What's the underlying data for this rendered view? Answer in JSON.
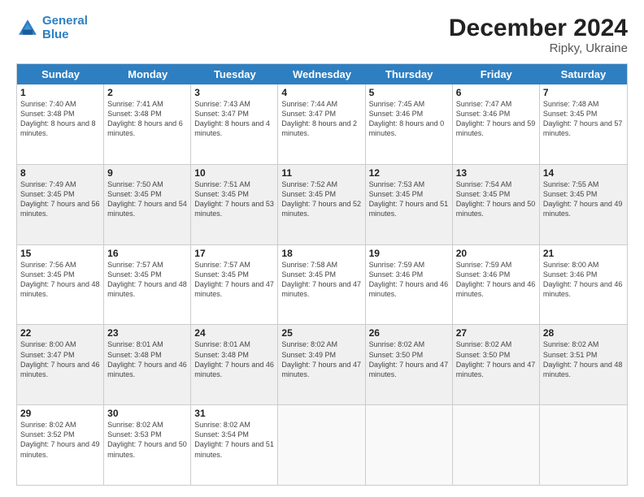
{
  "header": {
    "logo_line1": "General",
    "logo_line2": "Blue",
    "title": "December 2024",
    "subtitle": "Ripky, Ukraine"
  },
  "days_of_week": [
    "Sunday",
    "Monday",
    "Tuesday",
    "Wednesday",
    "Thursday",
    "Friday",
    "Saturday"
  ],
  "weeks": [
    [
      {
        "day": "1",
        "sunrise": "Sunrise: 7:40 AM",
        "sunset": "Sunset: 3:48 PM",
        "daylight": "Daylight: 8 hours and 8 minutes."
      },
      {
        "day": "2",
        "sunrise": "Sunrise: 7:41 AM",
        "sunset": "Sunset: 3:48 PM",
        "daylight": "Daylight: 8 hours and 6 minutes."
      },
      {
        "day": "3",
        "sunrise": "Sunrise: 7:43 AM",
        "sunset": "Sunset: 3:47 PM",
        "daylight": "Daylight: 8 hours and 4 minutes."
      },
      {
        "day": "4",
        "sunrise": "Sunrise: 7:44 AM",
        "sunset": "Sunset: 3:47 PM",
        "daylight": "Daylight: 8 hours and 2 minutes."
      },
      {
        "day": "5",
        "sunrise": "Sunrise: 7:45 AM",
        "sunset": "Sunset: 3:46 PM",
        "daylight": "Daylight: 8 hours and 0 minutes."
      },
      {
        "day": "6",
        "sunrise": "Sunrise: 7:47 AM",
        "sunset": "Sunset: 3:46 PM",
        "daylight": "Daylight: 7 hours and 59 minutes."
      },
      {
        "day": "7",
        "sunrise": "Sunrise: 7:48 AM",
        "sunset": "Sunset: 3:45 PM",
        "daylight": "Daylight: 7 hours and 57 minutes."
      }
    ],
    [
      {
        "day": "8",
        "sunrise": "Sunrise: 7:49 AM",
        "sunset": "Sunset: 3:45 PM",
        "daylight": "Daylight: 7 hours and 56 minutes."
      },
      {
        "day": "9",
        "sunrise": "Sunrise: 7:50 AM",
        "sunset": "Sunset: 3:45 PM",
        "daylight": "Daylight: 7 hours and 54 minutes."
      },
      {
        "day": "10",
        "sunrise": "Sunrise: 7:51 AM",
        "sunset": "Sunset: 3:45 PM",
        "daylight": "Daylight: 7 hours and 53 minutes."
      },
      {
        "day": "11",
        "sunrise": "Sunrise: 7:52 AM",
        "sunset": "Sunset: 3:45 PM",
        "daylight": "Daylight: 7 hours and 52 minutes."
      },
      {
        "day": "12",
        "sunrise": "Sunrise: 7:53 AM",
        "sunset": "Sunset: 3:45 PM",
        "daylight": "Daylight: 7 hours and 51 minutes."
      },
      {
        "day": "13",
        "sunrise": "Sunrise: 7:54 AM",
        "sunset": "Sunset: 3:45 PM",
        "daylight": "Daylight: 7 hours and 50 minutes."
      },
      {
        "day": "14",
        "sunrise": "Sunrise: 7:55 AM",
        "sunset": "Sunset: 3:45 PM",
        "daylight": "Daylight: 7 hours and 49 minutes."
      }
    ],
    [
      {
        "day": "15",
        "sunrise": "Sunrise: 7:56 AM",
        "sunset": "Sunset: 3:45 PM",
        "daylight": "Daylight: 7 hours and 48 minutes."
      },
      {
        "day": "16",
        "sunrise": "Sunrise: 7:57 AM",
        "sunset": "Sunset: 3:45 PM",
        "daylight": "Daylight: 7 hours and 48 minutes."
      },
      {
        "day": "17",
        "sunrise": "Sunrise: 7:57 AM",
        "sunset": "Sunset: 3:45 PM",
        "daylight": "Daylight: 7 hours and 47 minutes."
      },
      {
        "day": "18",
        "sunrise": "Sunrise: 7:58 AM",
        "sunset": "Sunset: 3:45 PM",
        "daylight": "Daylight: 7 hours and 47 minutes."
      },
      {
        "day": "19",
        "sunrise": "Sunrise: 7:59 AM",
        "sunset": "Sunset: 3:46 PM",
        "daylight": "Daylight: 7 hours and 46 minutes."
      },
      {
        "day": "20",
        "sunrise": "Sunrise: 7:59 AM",
        "sunset": "Sunset: 3:46 PM",
        "daylight": "Daylight: 7 hours and 46 minutes."
      },
      {
        "day": "21",
        "sunrise": "Sunrise: 8:00 AM",
        "sunset": "Sunset: 3:46 PM",
        "daylight": "Daylight: 7 hours and 46 minutes."
      }
    ],
    [
      {
        "day": "22",
        "sunrise": "Sunrise: 8:00 AM",
        "sunset": "Sunset: 3:47 PM",
        "daylight": "Daylight: 7 hours and 46 minutes."
      },
      {
        "day": "23",
        "sunrise": "Sunrise: 8:01 AM",
        "sunset": "Sunset: 3:48 PM",
        "daylight": "Daylight: 7 hours and 46 minutes."
      },
      {
        "day": "24",
        "sunrise": "Sunrise: 8:01 AM",
        "sunset": "Sunset: 3:48 PM",
        "daylight": "Daylight: 7 hours and 46 minutes."
      },
      {
        "day": "25",
        "sunrise": "Sunrise: 8:02 AM",
        "sunset": "Sunset: 3:49 PM",
        "daylight": "Daylight: 7 hours and 47 minutes."
      },
      {
        "day": "26",
        "sunrise": "Sunrise: 8:02 AM",
        "sunset": "Sunset: 3:50 PM",
        "daylight": "Daylight: 7 hours and 47 minutes."
      },
      {
        "day": "27",
        "sunrise": "Sunrise: 8:02 AM",
        "sunset": "Sunset: 3:50 PM",
        "daylight": "Daylight: 7 hours and 47 minutes."
      },
      {
        "day": "28",
        "sunrise": "Sunrise: 8:02 AM",
        "sunset": "Sunset: 3:51 PM",
        "daylight": "Daylight: 7 hours and 48 minutes."
      }
    ],
    [
      {
        "day": "29",
        "sunrise": "Sunrise: 8:02 AM",
        "sunset": "Sunset: 3:52 PM",
        "daylight": "Daylight: 7 hours and 49 minutes."
      },
      {
        "day": "30",
        "sunrise": "Sunrise: 8:02 AM",
        "sunset": "Sunset: 3:53 PM",
        "daylight": "Daylight: 7 hours and 50 minutes."
      },
      {
        "day": "31",
        "sunrise": "Sunrise: 8:02 AM",
        "sunset": "Sunset: 3:54 PM",
        "daylight": "Daylight: 7 hours and 51 minutes."
      },
      null,
      null,
      null,
      null
    ]
  ]
}
